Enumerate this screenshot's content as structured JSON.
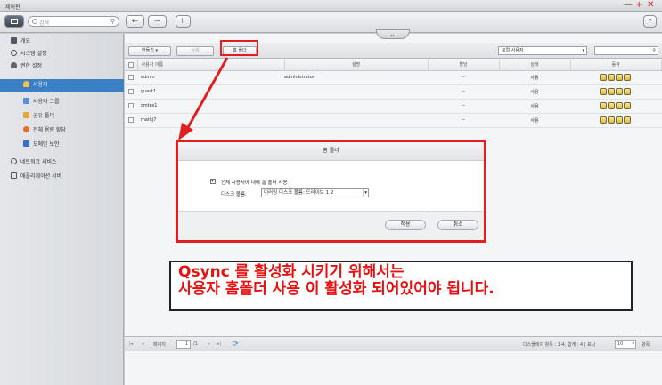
{
  "window": {
    "title": "제어판",
    "controls": [
      "—",
      "+",
      "✕"
    ]
  },
  "search": {
    "placeholder": "검색"
  },
  "toolbar": {
    "help": "?"
  },
  "sidebar": {
    "items": [
      {
        "label": "개요",
        "icon": "grid-icon"
      },
      {
        "label": "시스템 설정",
        "icon": "gear-icon"
      },
      {
        "label": "권한 설정",
        "icon": "user-icon"
      },
      {
        "label": "사용자",
        "icon": "user-icon"
      },
      {
        "label": "사용자 그룹",
        "icon": "group-icon"
      },
      {
        "label": "공유 폴더",
        "icon": "folder-icon"
      },
      {
        "label": "전체 용량 할당",
        "icon": "pie-icon"
      },
      {
        "label": "도메인 보안",
        "icon": "domain-icon"
      },
      {
        "label": "네트워크 서비스",
        "icon": "globe-icon"
      },
      {
        "label": "애플리케이션 서버",
        "icon": "server-icon"
      }
    ]
  },
  "actions": {
    "create": "만들기",
    "delete": "삭제",
    "homefolder": "홈 폴더",
    "filter": "로컬 사용자"
  },
  "table": {
    "headers": [
      "사용자 이름",
      "설명",
      "할당",
      "상태",
      "동작"
    ],
    "rows": [
      {
        "name": "admin",
        "desc": "administrator",
        "quota": "--",
        "status": "사용"
      },
      {
        "name": "guest1",
        "desc": "",
        "quota": "--",
        "status": "사용"
      },
      {
        "name": "cmtes1",
        "desc": "",
        "quota": "--",
        "status": "사용"
      },
      {
        "name": "markj7",
        "desc": "",
        "quota": "--",
        "status": "사용"
      }
    ]
  },
  "footer": {
    "page_label": "페이지",
    "page": "1",
    "page_total": "/1",
    "summary": "디스플레이 항목 : 1-4, 합계 : 4 | 표시",
    "per_page": "10",
    "per_page_suffix": "항목"
  },
  "dialog": {
    "title": "홈 폴더",
    "checkbox_label": "전체 사용자에 대해 홈 폴더 사용",
    "volume_label": "디스크 볼륨:",
    "volume_value": "미러링 디스크 볼륨: 드라이브 1 2",
    "apply": "적용",
    "cancel": "취소"
  },
  "caption": {
    "line1": "Qsync 를 활성화 시키기 위해서는",
    "line2": "사용자 홈폴더  사용 이 활성화 되어있어야 됩니다."
  },
  "colors": {
    "highlight": "#e02020",
    "selected": "#3b7fc4"
  }
}
